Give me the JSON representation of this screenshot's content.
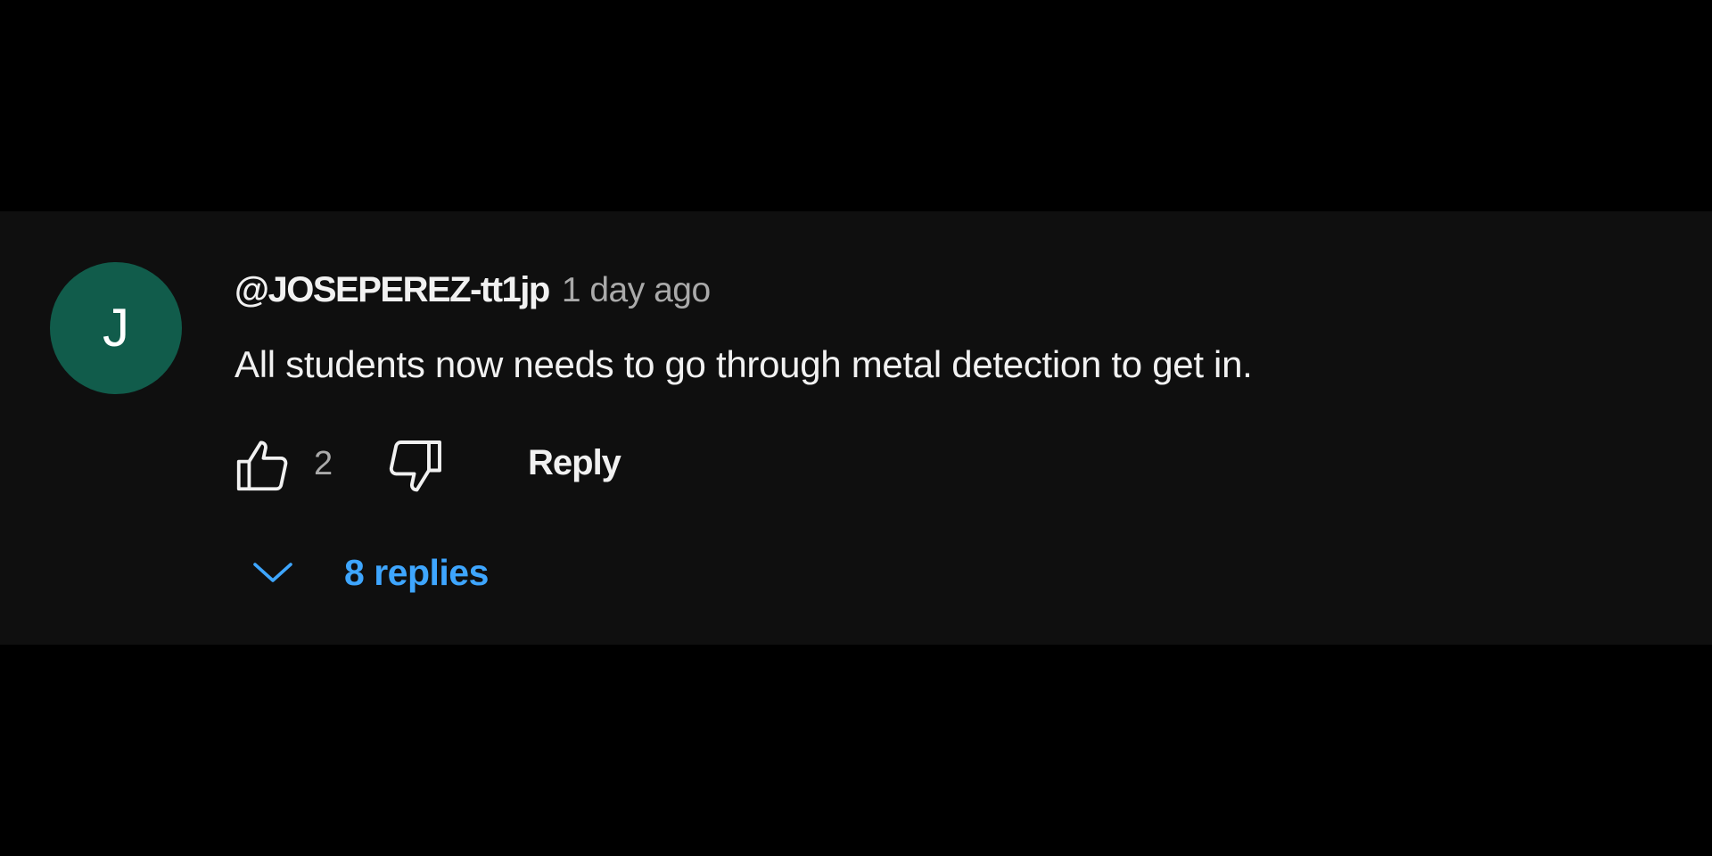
{
  "comment": {
    "avatar_letter": "J",
    "avatar_color": "#115c4b",
    "author": "@JOSEPEREZ-tt1jp",
    "timestamp": "1 day ago",
    "text": "All students now needs to go through metal detection to get in.",
    "actions": {
      "like_icon": "thumbs-up-icon",
      "like_count": "2",
      "dislike_icon": "thumbs-down-icon",
      "reply_label": "Reply"
    },
    "replies": {
      "icon": "chevron-down-icon",
      "label": "8 replies",
      "color": "#3ea6ff"
    }
  }
}
